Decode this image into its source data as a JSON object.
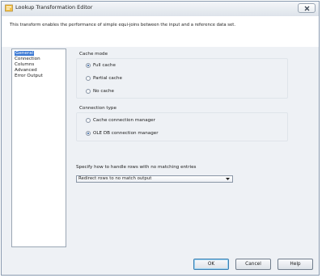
{
  "window": {
    "title": "Lookup Transformation Editor"
  },
  "header": {
    "description": "This transform enables the performance of simple equi-joins between the input and a reference data set."
  },
  "nav": {
    "items": [
      {
        "label": "General",
        "selected": true
      },
      {
        "label": "Connection",
        "selected": false
      },
      {
        "label": "Columns",
        "selected": false
      },
      {
        "label": "Advanced",
        "selected": false
      },
      {
        "label": "Error Output",
        "selected": false
      }
    ]
  },
  "cache_mode": {
    "label": "Cache mode",
    "options": [
      {
        "label": "Full cache",
        "checked": true
      },
      {
        "label": "Partial cache",
        "checked": false
      },
      {
        "label": "No cache",
        "checked": false
      }
    ]
  },
  "connection_type": {
    "label": "Connection type",
    "options": [
      {
        "label": "Cache connection manager",
        "checked": false
      },
      {
        "label": "OLE DB connection manager",
        "checked": true
      }
    ]
  },
  "no_match": {
    "label": "Specify how to handle rows with no matching entries",
    "selected_value": "Redirect rows to no match output"
  },
  "buttons": {
    "ok": "OK",
    "cancel": "Cancel",
    "help": "Help"
  },
  "colors": {
    "selection": "#3a78d4",
    "dialog_bg": "#eef1f5"
  }
}
